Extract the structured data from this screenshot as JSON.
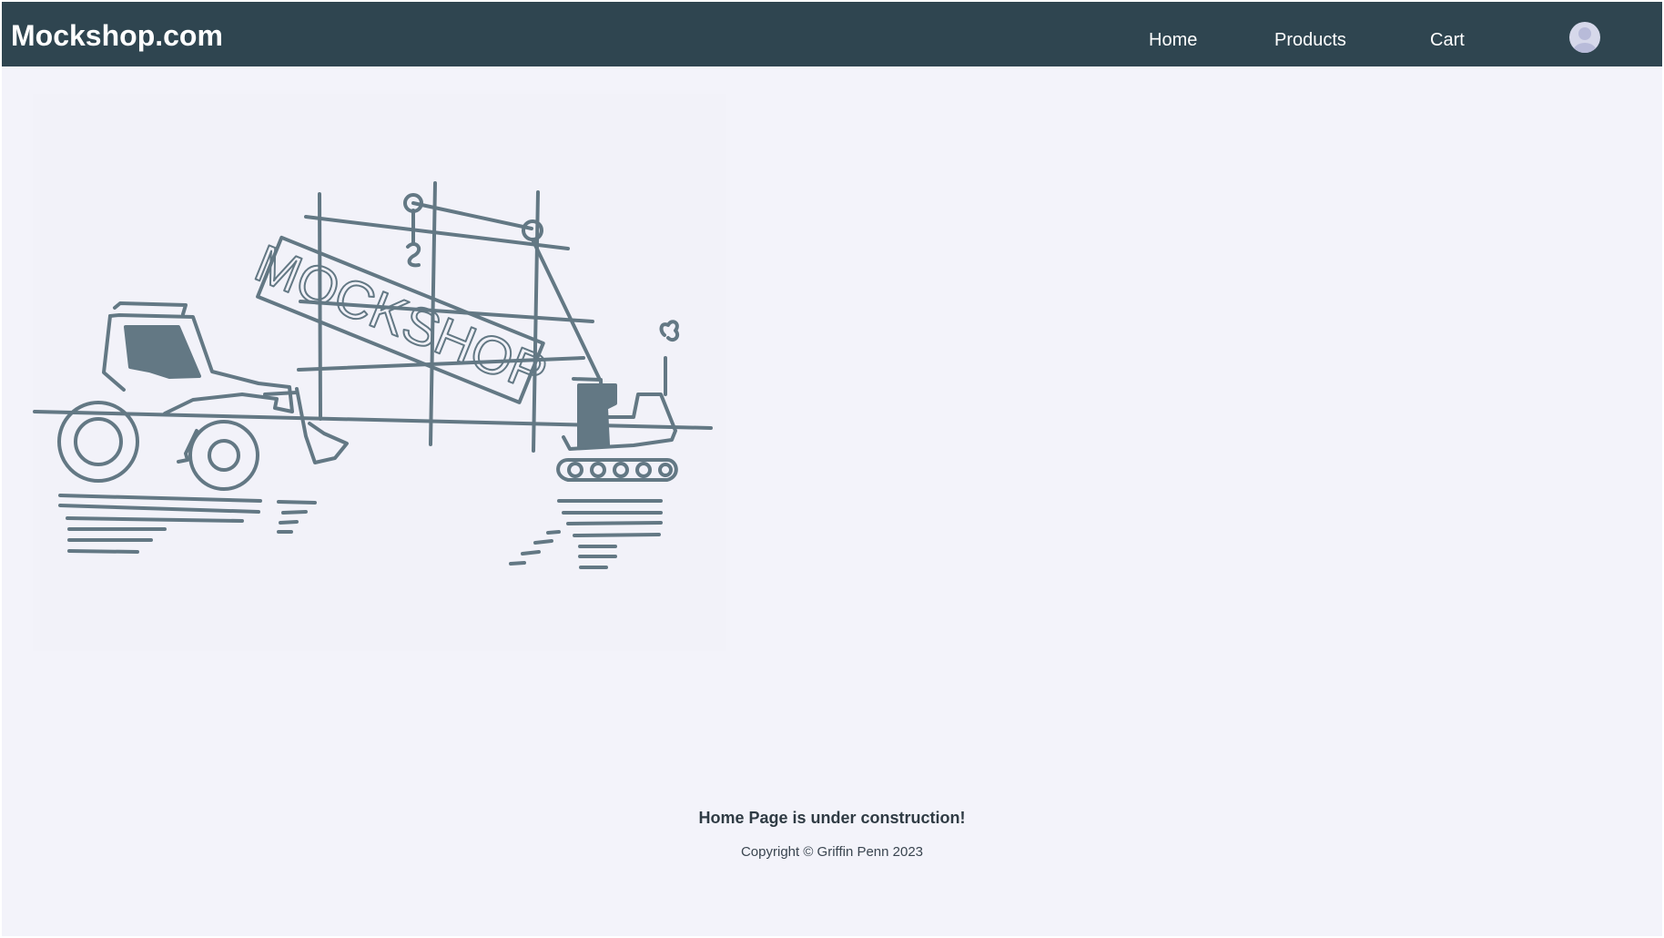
{
  "header": {
    "brand": "Mockshop.com",
    "nav": [
      {
        "label": "Home"
      },
      {
        "label": "Products"
      },
      {
        "label": "Cart"
      }
    ],
    "avatar_icon": "user-avatar-icon"
  },
  "illustration": {
    "sign_text": "MOCKSHOP",
    "icon": "construction-illustration"
  },
  "footer": {
    "message": "Home Page is under construction!",
    "copyright": "Copyright © Griffin Penn 2023"
  },
  "colors": {
    "navbar": "#2f4550",
    "background": "#f3f3fa",
    "illustration_stroke": "#637884"
  }
}
